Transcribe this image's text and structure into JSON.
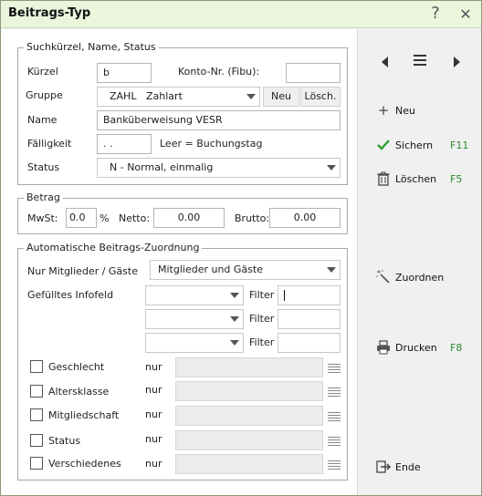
{
  "window": {
    "title": "Beitrags-Typ",
    "help_glyph": "?",
    "close_glyph": "✕"
  },
  "search_group": {
    "legend": "Suchkürzel, Name, Status",
    "kuerzel_label": "Kürzel",
    "kuerzel_value": "b",
    "konto_label": "Konto-Nr. (Fibu):",
    "konto_value": "",
    "gruppe_label": "Gruppe",
    "gruppe_code": "ZAHL",
    "gruppe_value": "Zahlart",
    "neu_label": "Neu",
    "loesch_label": "Lösch.",
    "name_label": "Name",
    "name_value": "Banküberweisung VESR",
    "faelligkeit_label": "Fälligkeit",
    "faelligkeit_value": ". .",
    "faelligkeit_hint": "Leer = Buchungstag",
    "status_label": "Status",
    "status_value": "N - Normal, einmalig"
  },
  "betrag_group": {
    "legend": "Betrag",
    "mwst_label": "MwSt:",
    "mwst_value": "0.0",
    "percent": "%",
    "netto_label": "Netto:",
    "netto_value": "0.00",
    "brutto_label": "Brutto:",
    "brutto_value": "0.00"
  },
  "auto_group": {
    "legend": "Automatische Beitrags-Zuordnung",
    "nur_label": "Nur Mitglieder / Gäste",
    "nur_value": "Mitglieder und Gäste",
    "infofeld_label": "Gefülltes Infofeld",
    "filter_label": "Filter",
    "filters": [
      "",
      "",
      ""
    ],
    "checks": [
      {
        "label": "Geschlecht",
        "nur": "nur"
      },
      {
        "label": "Altersklasse",
        "nur": "nur"
      },
      {
        "label": "Mitgliedschaft",
        "nur": "nur"
      },
      {
        "label": "Status",
        "nur": "nur"
      },
      {
        "label": "Verschiedenes",
        "nur": "nur"
      }
    ]
  },
  "sidebar": {
    "neu": "Neu",
    "sichern": "Sichern",
    "sichern_key": "F11",
    "loeschen": "Löschen",
    "loeschen_key": "F5",
    "zuordnen": "Zuordnen",
    "drucken": "Drucken",
    "drucken_key": "F8",
    "ende": "Ende"
  },
  "colors": {
    "titlebar": "#eaf5dc",
    "shortcut": "#2e8b2e",
    "check_icon": "#2e9e2e"
  }
}
